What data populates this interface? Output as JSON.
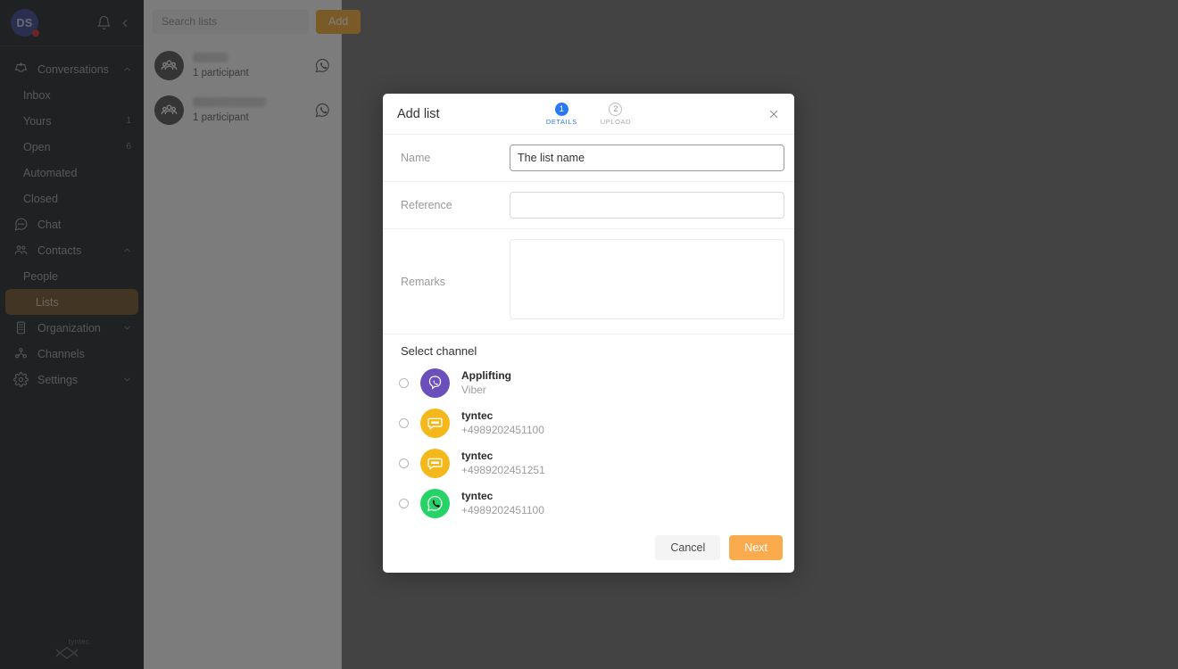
{
  "sidebar": {
    "avatar_initials": "DS",
    "avatar_color": "#2e3a8c",
    "notification_dot_color": "#cc2222",
    "icons": {
      "bell": "bell-icon",
      "collapse": "chevron-left-icon"
    },
    "items": [
      {
        "label": "Conversations",
        "icon": "inbox-tray-icon",
        "level": "top",
        "chevron": "up",
        "count": ""
      },
      {
        "label": "Inbox",
        "icon": "",
        "level": "sub",
        "chevron": "",
        "count": ""
      },
      {
        "label": "Yours",
        "icon": "",
        "level": "sub",
        "chevron": "",
        "count": "1"
      },
      {
        "label": "Open",
        "icon": "",
        "level": "sub",
        "chevron": "",
        "count": "6"
      },
      {
        "label": "Automated",
        "icon": "",
        "level": "sub",
        "chevron": "",
        "count": ""
      },
      {
        "label": "Closed",
        "icon": "",
        "level": "sub",
        "chevron": "",
        "count": ""
      },
      {
        "label": "Chat",
        "icon": "chat-bubble-icon",
        "level": "top",
        "chevron": "",
        "count": ""
      },
      {
        "label": "Contacts",
        "icon": "people-icon",
        "level": "top",
        "chevron": "up",
        "count": ""
      },
      {
        "label": "People",
        "icon": "",
        "level": "sub",
        "chevron": "",
        "count": ""
      },
      {
        "label": "Lists",
        "icon": "",
        "level": "sub-active",
        "chevron": "",
        "count": ""
      },
      {
        "label": "Organization",
        "icon": "building-icon",
        "level": "top",
        "chevron": "down",
        "count": ""
      },
      {
        "label": "Channels",
        "icon": "nodes-icon",
        "level": "top",
        "chevron": "",
        "count": ""
      },
      {
        "label": "Settings",
        "icon": "gear-icon",
        "level": "top",
        "chevron": "down",
        "count": ""
      }
    ],
    "active_item": "Lists",
    "active_color": "#6b4a1e",
    "brand_logo_text": "tyntec"
  },
  "list_panel": {
    "search_placeholder": "Search lists",
    "search_value": "",
    "add_label": "Add",
    "add_color": "#f5a623",
    "items": [
      {
        "name_redacted": true,
        "name_width": 40,
        "participants": "1 participant",
        "channel_icon": "whatsapp-icon"
      },
      {
        "name_redacted": true,
        "name_width": 82,
        "participants": "1 participant",
        "channel_icon": "whatsapp-icon"
      }
    ]
  },
  "modal": {
    "title": "Add list",
    "close_icon": "close-icon",
    "steps": [
      {
        "number": "1",
        "label": "DETAILS",
        "state": "active"
      },
      {
        "number": "2",
        "label": "UPLOAD",
        "state": "inactive"
      }
    ],
    "step_active_color": "#2979f5",
    "fields": [
      {
        "label": "Name",
        "value": "The list name",
        "placeholder": "",
        "type": "input",
        "focused": true
      },
      {
        "label": "Reference",
        "value": "",
        "placeholder": "",
        "type": "input",
        "focused": false
      },
      {
        "label": "Remarks",
        "value": "",
        "placeholder": "",
        "type": "textarea",
        "focused": false
      }
    ],
    "channel_section_title": "Select channel",
    "channels": [
      {
        "name": "Applifting",
        "detail": "Viber",
        "icon": "viber-icon",
        "color": "#6b4fbb",
        "selected": false
      },
      {
        "name": "tyntec",
        "detail": "+4989202451100",
        "icon": "sms-icon",
        "color": "#f5b81a",
        "selected": false
      },
      {
        "name": "tyntec",
        "detail": "+4989202451251",
        "icon": "sms-icon",
        "color": "#f5b81a",
        "selected": false
      },
      {
        "name": "tyntec",
        "detail": "+4989202451100",
        "icon": "whatsapp-icon",
        "color": "#25d366",
        "selected": false
      }
    ],
    "cancel_label": "Cancel",
    "next_label": "Next",
    "next_color": "#f9ab4e"
  }
}
